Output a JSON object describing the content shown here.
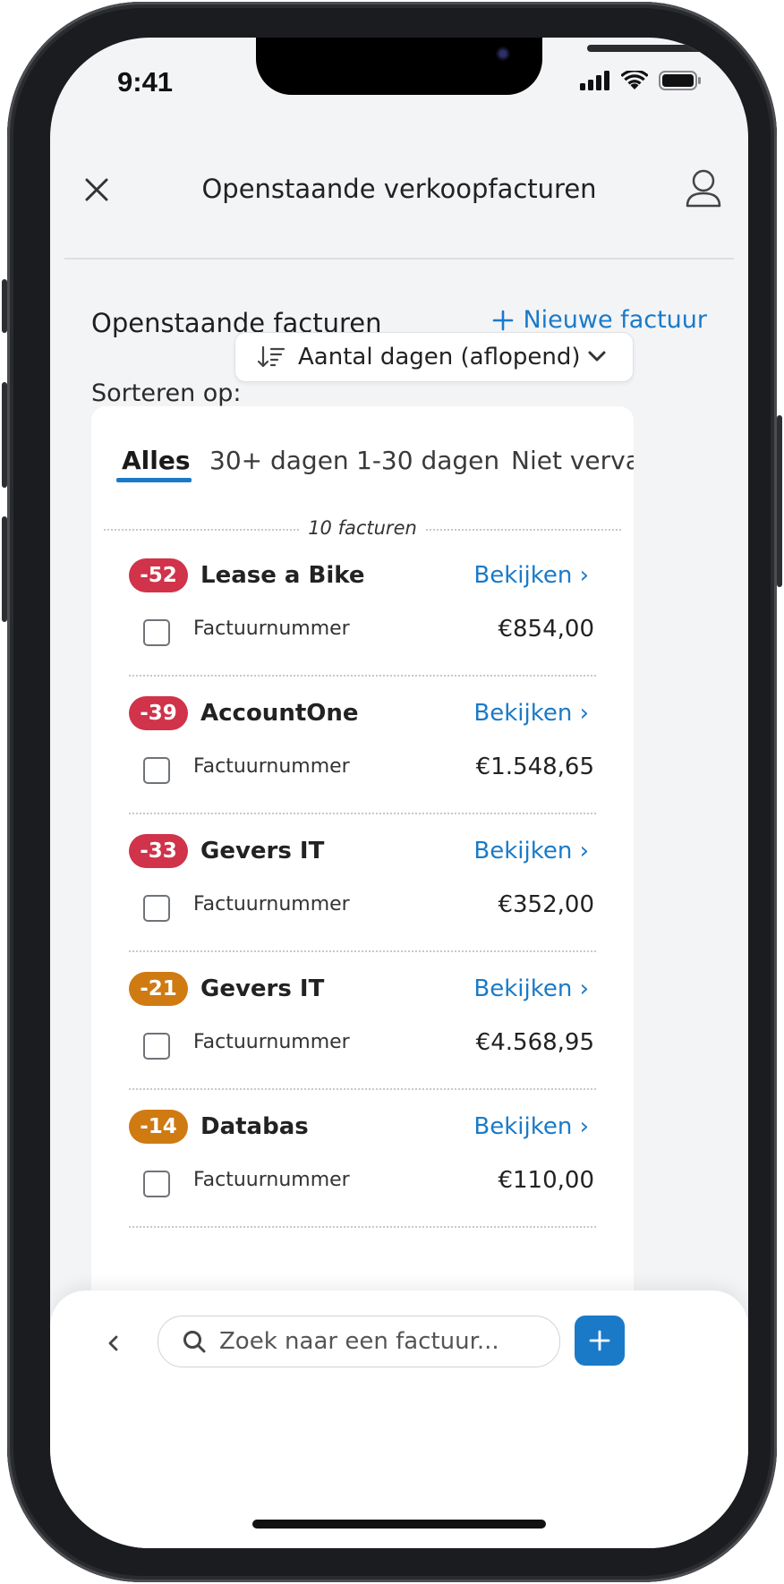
{
  "status_bar": {
    "time": "9:41"
  },
  "nav": {
    "title": "Openstaande verkoopfacturen"
  },
  "section": {
    "title": "Openstaande facturen",
    "new_invoice_label": "Nieuwe factuur"
  },
  "sort": {
    "label": "Sorteren op:",
    "value": "Aantal dagen (aflopend)"
  },
  "tabs": [
    {
      "label": "Alles"
    },
    {
      "label": "30+ dagen"
    },
    {
      "label": "1-30 dagen"
    },
    {
      "label": "Niet vervallen"
    }
  ],
  "count_text": "10 facturen",
  "invoices": [
    {
      "days": "-52",
      "severity": "red",
      "client": "Lease a Bike",
      "link": "Bekijken",
      "label": "Factuurnummer",
      "amount": "€854,00"
    },
    {
      "days": "-39",
      "severity": "red",
      "client": "AccountOne",
      "link": "Bekijken",
      "label": "Factuurnummer",
      "amount": "€1.548,65"
    },
    {
      "days": "-33",
      "severity": "red",
      "client": "Gevers IT",
      "link": "Bekijken",
      "label": "Factuurnummer",
      "amount": "€352,00"
    },
    {
      "days": "-21",
      "severity": "orange",
      "client": "Gevers IT",
      "link": "Bekijken",
      "label": "Factuurnummer",
      "amount": "€4.568,95"
    },
    {
      "days": "-14",
      "severity": "orange",
      "client": "Databas",
      "link": "Bekijken",
      "label": "Factuurnummer",
      "amount": "€110,00"
    }
  ],
  "search": {
    "placeholder": "Zoek naar een factuur..."
  },
  "colors": {
    "accent": "#1a7ac8",
    "overdue_red": "#d0334a",
    "overdue_orange": "#d07a12"
  },
  "icons": {
    "close": "close-icon",
    "user": "user-icon",
    "plus": "plus-icon",
    "sort": "sort-descending-icon",
    "dropdown": "chevron-down-icon",
    "link_chevron": "chevron-right-icon",
    "back": "chevron-left-icon",
    "search": "search-icon"
  }
}
